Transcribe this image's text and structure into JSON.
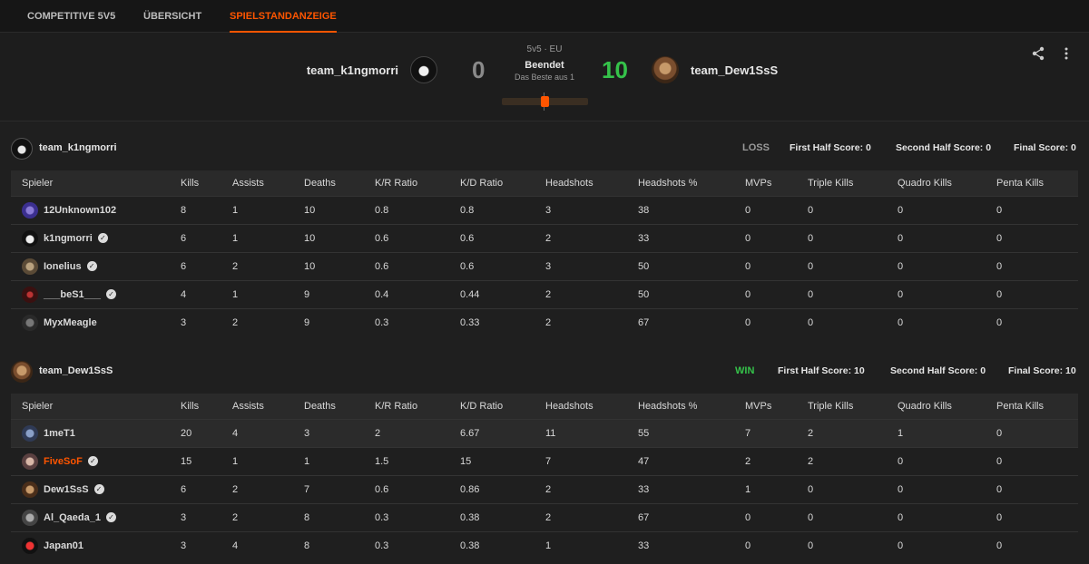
{
  "tabs": [
    "COMPETITIVE 5V5",
    "ÜBERSICHT",
    "SPIELSTANDANZEIGE"
  ],
  "match": {
    "mode": "5v5 · EU",
    "status": "Beendet",
    "best_of": "Das Beste aus 1",
    "team1": "team_k1ngmorri",
    "team2": "team_Dew1SsS",
    "score1": "0",
    "score2": "10"
  },
  "columns": [
    "Spieler",
    "Kills",
    "Assists",
    "Deaths",
    "K/R Ratio",
    "K/D Ratio",
    "Headshots",
    "Headshots %",
    "MVPs",
    "Triple Kills",
    "Quadro Kills",
    "Penta Kills"
  ],
  "teams": [
    {
      "name": "team_k1ngmorri",
      "result": "LOSS",
      "first_half": "First Half Score: 0",
      "second_half": "Second Half Score: 0",
      "final": "Final Score: 0",
      "players": [
        {
          "name": "12Unknown102",
          "verified": false,
          "stats": [
            "8",
            "1",
            "10",
            "0.8",
            "0.8",
            "3",
            "38",
            "0",
            "0",
            "0",
            "0"
          ]
        },
        {
          "name": "k1ngmorri",
          "verified": true,
          "stats": [
            "6",
            "1",
            "10",
            "0.6",
            "0.6",
            "2",
            "33",
            "0",
            "0",
            "0",
            "0"
          ]
        },
        {
          "name": "Ionelius",
          "verified": true,
          "stats": [
            "6",
            "2",
            "10",
            "0.6",
            "0.6",
            "3",
            "50",
            "0",
            "0",
            "0",
            "0"
          ]
        },
        {
          "name": "___beS1___",
          "verified": true,
          "stats": [
            "4",
            "1",
            "9",
            "0.4",
            "0.44",
            "2",
            "50",
            "0",
            "0",
            "0",
            "0"
          ]
        },
        {
          "name": "MyxMeagle",
          "verified": false,
          "stats": [
            "3",
            "2",
            "9",
            "0.3",
            "0.33",
            "2",
            "67",
            "0",
            "0",
            "0",
            "0"
          ]
        }
      ]
    },
    {
      "name": "team_Dew1SsS",
      "result": "WIN",
      "first_half": "First Half Score: 10",
      "second_half": "Second Half Score: 0",
      "final": "Final Score: 10",
      "players": [
        {
          "name": "1meT1",
          "verified": false,
          "stats": [
            "20",
            "4",
            "3",
            "2",
            "6.67",
            "11",
            "55",
            "7",
            "2",
            "1",
            "0"
          ]
        },
        {
          "name": "FiveSoF",
          "verified": true,
          "stats": [
            "15",
            "1",
            "1",
            "1.5",
            "15",
            "7",
            "47",
            "2",
            "2",
            "0",
            "0"
          ]
        },
        {
          "name": "Dew1SsS",
          "verified": true,
          "stats": [
            "6",
            "2",
            "7",
            "0.6",
            "0.86",
            "2",
            "33",
            "1",
            "0",
            "0",
            "0"
          ]
        },
        {
          "name": "Al_Qaeda_1",
          "verified": true,
          "stats": [
            "3",
            "2",
            "8",
            "0.3",
            "0.38",
            "2",
            "67",
            "0",
            "0",
            "0",
            "0"
          ]
        },
        {
          "name": "Japan01",
          "verified": false,
          "stats": [
            "3",
            "4",
            "8",
            "0.3",
            "0.38",
            "1",
            "33",
            "0",
            "0",
            "0",
            "0"
          ]
        }
      ]
    }
  ],
  "colors": {
    "accent": "#ff5500",
    "win": "#35c24a",
    "background": "#1f1f1f"
  },
  "icons": [
    "share-icon",
    "more-icon",
    "verified-icon"
  ]
}
